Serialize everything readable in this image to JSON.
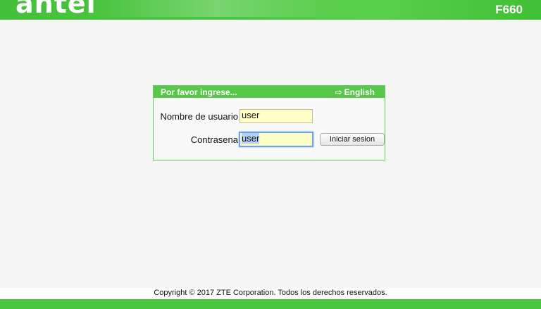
{
  "header": {
    "brand": "antel",
    "model": "F660"
  },
  "login": {
    "title": "Por favor ingrese...",
    "language_link": "English",
    "username_label": "Nombre de usuario",
    "username_value": "user",
    "password_label": "Contrasena",
    "password_value": "user",
    "submit_label": "Iniciar sesion"
  },
  "footer": {
    "copyright": "Copyright © 2017 ZTE Corporation. Todos los derechos reservados."
  },
  "colors": {
    "brand_green": "#4cc840",
    "input_background": "#ffffc6",
    "focus_outline": "#6aa4e8"
  }
}
